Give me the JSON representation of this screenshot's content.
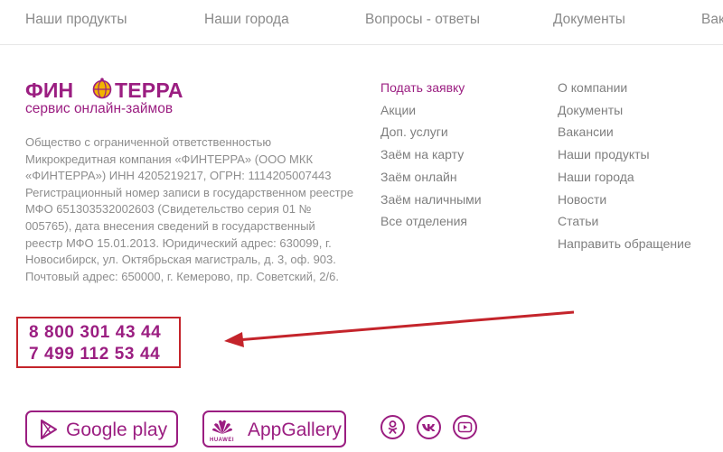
{
  "nav": [
    {
      "label": "Наши продукты"
    },
    {
      "label": "Наши города"
    },
    {
      "label": "Вопросы - ответы"
    },
    {
      "label": "Документы"
    },
    {
      "label": "Вак"
    }
  ],
  "logo": {
    "brand_left": "ФИН",
    "brand_right": "ТЕРРА",
    "tagline": "сервис онлайн-займов",
    "globe_icon": "globe-icon"
  },
  "legal_text": "Общество с ограниченной ответственностью Микрокредитная компания «ФИНТЕРРА» (ООО МКК «ФИНТЕРРА») ИНН 4205219217, ОГРН: 1114205007443 Регистрационный номер записи в государственном реестре МФО 651303532002603 (Свидетельство серия 01 № 005765), дата внесения сведений в государственный реестр МФО 15.01.2013. Юридический адрес: 630099, г. Новосибирск, ул. Октябрьская магистраль, д. 3, оф. 903. Почтовый адрес: 650000, г. Кемерово, пр. Советский, 2/6.",
  "phones": [
    "8 800 301 43 44",
    "7 499 112 53 44"
  ],
  "links_col1": [
    "Подать заявку",
    "Акции",
    "Доп. услуги",
    "Заём на карту",
    "Заём онлайн",
    "Заём наличными",
    "Все отделения"
  ],
  "links_col2": [
    "О компании",
    "Документы",
    "Вакансии",
    "Наши продукты",
    "Наши города",
    "Новости",
    "Статьи",
    "Направить обращение"
  ],
  "apps": {
    "google_play": "Google play",
    "app_gallery": "AppGallery",
    "huawei_label": "HUAWEI"
  },
  "social_icons": [
    "odnoklassniki-icon",
    "vk-icon",
    "youtube-icon"
  ],
  "colors": {
    "brand": "#9b1e81",
    "annotation": "#c4242b",
    "text": "#8d8d8d"
  }
}
